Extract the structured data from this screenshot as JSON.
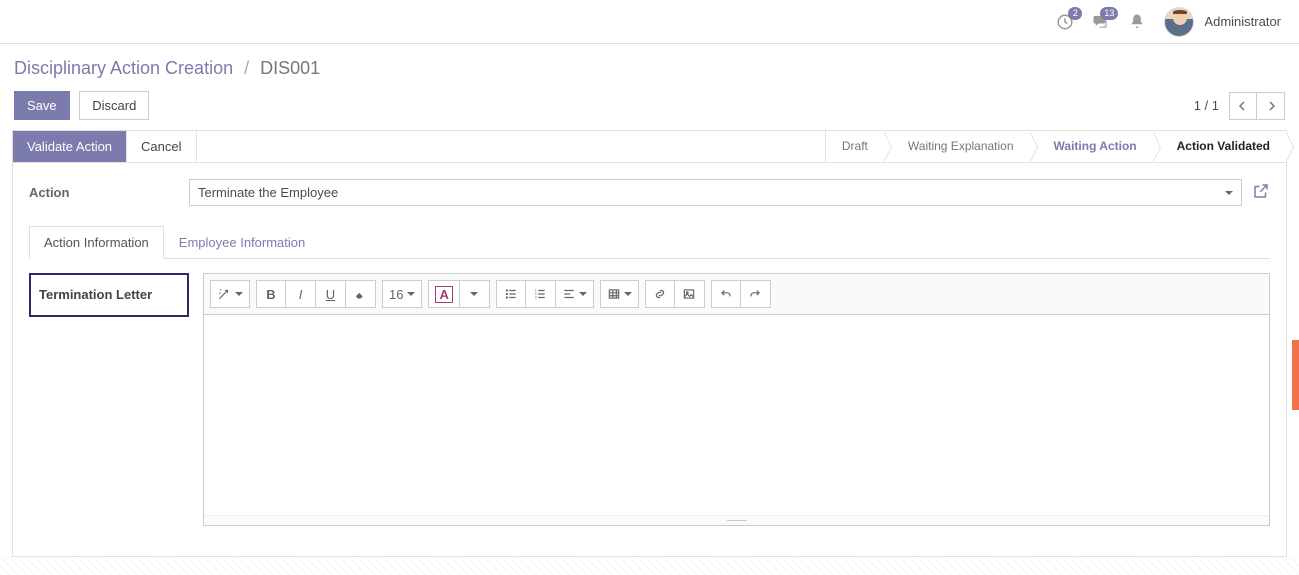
{
  "topbar": {
    "badges": {
      "activity": "2",
      "messages": "13"
    },
    "username": "Administrator"
  },
  "breadcrumb": {
    "section": "Disciplinary Action Creation",
    "record": "DIS001"
  },
  "buttons": {
    "save": "Save",
    "discard": "Discard",
    "validate": "Validate Action",
    "cancel": "Cancel"
  },
  "paging": {
    "text": "1 / 1"
  },
  "status": {
    "steps": [
      "Draft",
      "Waiting Explanation",
      "Waiting Action",
      "Action Validated"
    ],
    "active_index": 2
  },
  "fields": {
    "action_label": "Action",
    "action_value": "Terminate the Employee"
  },
  "tabs": {
    "action_info": "Action Information",
    "employee_info": "Employee Information"
  },
  "letter": {
    "label": "Termination Letter"
  },
  "editor": {
    "font_size": "16"
  },
  "icons": {
    "clock": "clock-icon",
    "chat": "chat-icon",
    "bell": "bell-icon",
    "chevron_left": "chevron-left-icon",
    "chevron_right": "chevron-right-icon",
    "external": "external-link-icon",
    "caret_down": "caret-down-icon"
  }
}
